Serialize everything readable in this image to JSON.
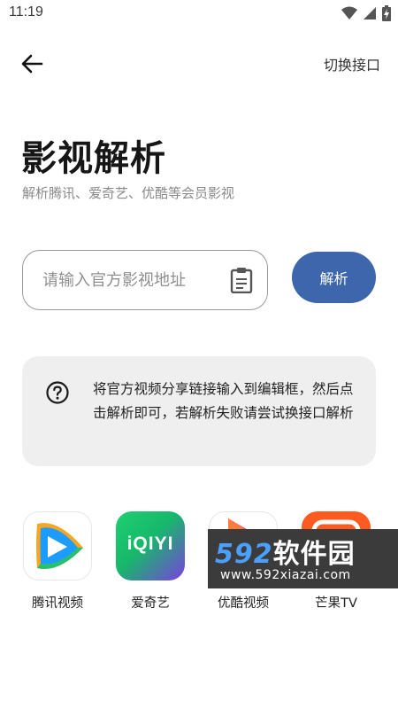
{
  "status_bar": {
    "time": "11:19",
    "icons": [
      "wifi-icon",
      "signal-icon",
      "battery-icon"
    ]
  },
  "top_bar": {
    "back_icon": "arrow-left-icon",
    "switch_label": "切换接口"
  },
  "page": {
    "title": "影视解析",
    "subtitle": "解析腾讯、爱奇艺、优酷等会员影视"
  },
  "url_input": {
    "placeholder": "请输入官方影视地址",
    "value": "",
    "paste_icon": "clipboard-icon"
  },
  "parse_button": {
    "label": "解析"
  },
  "help_card": {
    "icon": "question-circle-icon",
    "text": "将官方视频分享链接输入到编辑框，然后点击解析即可，若解析失败请尝试换接口解析"
  },
  "platforms": [
    {
      "label": "腾讯视频",
      "icon": "tencent-video-logo"
    },
    {
      "label": "爱奇艺",
      "icon": "iqiyi-logo",
      "logo_text": "iQIYI"
    },
    {
      "label": "优酷视频",
      "icon": "youku-logo"
    },
    {
      "label": "芒果TV",
      "icon": "mango-tv-logo"
    }
  ],
  "watermark": {
    "brand_num": "592",
    "brand_text": "软件园",
    "url": "www.592xiazai.com"
  },
  "colors": {
    "accent": "#3d66ad",
    "card_bg": "#efefef",
    "input_border": "#9a9a9a"
  }
}
